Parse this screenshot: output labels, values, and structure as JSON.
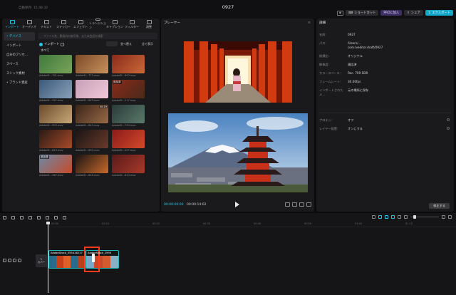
{
  "titlebar": {
    "autosave": "自動保存: 15:48:32",
    "title": "0927",
    "shortcut": "ショートカット",
    "pro": "PROに加入",
    "share": "シェア",
    "export": "エクスポート"
  },
  "toolbar": [
    {
      "label": "インポート",
      "icon": "import-icon",
      "active": true
    },
    {
      "label": "オーディオ",
      "icon": "audio-icon",
      "active": false
    },
    {
      "label": "テキスト",
      "icon": "text-icon",
      "active": false
    },
    {
      "label": "ステッカー",
      "icon": "sticker-icon",
      "active": false
    },
    {
      "label": "エフェクト",
      "icon": "effect-icon",
      "active": false
    },
    {
      "label": "トランジション",
      "icon": "transition-icon",
      "active": false
    },
    {
      "label": "キャプション",
      "icon": "caption-icon",
      "active": false
    },
    {
      "label": "フィルター",
      "icon": "filter-icon",
      "active": false
    },
    {
      "label": "調整",
      "icon": "adjust-icon",
      "active": false
    }
  ],
  "sidebar": [
    {
      "label": "• デバイス",
      "active": true
    },
    {
      "label": "インポート",
      "active": false
    },
    {
      "label": "自分のプリセ…",
      "active": false
    },
    {
      "label": "スペース",
      "active": false
    },
    {
      "label": "ストック素材",
      "active": false
    },
    {
      "label": "• ブランド資産",
      "active": false
    }
  ],
  "media": {
    "search_placeholder": "ファイル名、動画内の被写体、または会話を検索",
    "import_label": "インポート",
    "filter_label": "全て表示",
    "all_label": "すべて",
    "sort_label": "並べ替え",
    "items": [
      {
        "caption": "AdobeSt…791.mov",
        "duration": "",
        "badge": "",
        "colors": [
          "#3f7a3c",
          "#7aa35a"
        ]
      },
      {
        "caption": "AdobeSt…773.mov",
        "duration": "",
        "badge": "",
        "colors": [
          "#7a4a2a",
          "#c9915a"
        ]
      },
      {
        "caption": "AdobeSt…603.mov",
        "duration": "",
        "badge": "",
        "colors": [
          "#8a2a1a",
          "#c96a3a"
        ]
      },
      {
        "caption": "AdobeSt…421.mov",
        "duration": "",
        "badge": "",
        "colors": [
          "#3a5a7a",
          "#8aa0b8"
        ]
      },
      {
        "caption": "AdobeSt…643.mov",
        "duration": "",
        "badge": "",
        "colors": [
          "#c8a0b8",
          "#f0c8d8"
        ]
      },
      {
        "caption": "AdobeSt…217.mov",
        "duration": "",
        "badge": "追加済",
        "colors": [
          "#8a2a1a",
          "#4a2a1a"
        ]
      },
      {
        "caption": "AdobeSt…993.mov",
        "duration": "",
        "badge": "",
        "colors": [
          "#6a4a2a",
          "#c8a878"
        ]
      },
      {
        "caption": "AdobeSt…643.mov",
        "duration": "00:19",
        "badge": "",
        "colors": [
          "#3a2418",
          "#9a6a48"
        ]
      },
      {
        "caption": "AdobeSt…793.mov",
        "duration": "",
        "badge": "",
        "colors": [
          "#2a3a3a",
          "#5a7a6a"
        ]
      },
      {
        "caption": "AdobeSt…843.mov",
        "duration": "",
        "badge": "",
        "colors": [
          "#2a1a14",
          "#a84a2a"
        ]
      },
      {
        "caption": "AdobeSt…693.mov",
        "duration": "",
        "badge": "",
        "colors": [
          "#1a1414",
          "#6a3a2a"
        ]
      },
      {
        "caption": "AdobeSt…207.mov",
        "duration": "",
        "badge": "",
        "colors": [
          "#8a1a1a",
          "#d44a2a"
        ]
      },
      {
        "caption": "AdobeSt…267.mov",
        "duration": "",
        "badge": "追加済",
        "colors": [
          "#6a8aa8",
          "#c84a2a"
        ]
      },
      {
        "caption": "AdobeSt…846.mov",
        "duration": "",
        "badge": "",
        "colors": [
          "#1a1414",
          "#c86a2a"
        ]
      },
      {
        "caption": "AdobeSt…843.mov",
        "duration": "",
        "badge": "",
        "colors": [
          "#5a1a1a",
          "#a83a2a"
        ]
      }
    ]
  },
  "player": {
    "title": "プレーヤー",
    "current_time": "00:00:00:00",
    "total_time": "00:00:14:02"
  },
  "details": {
    "title": "詳細",
    "rows": [
      {
        "k": "名前:",
        "v": "0927"
      },
      {
        "k": "パス:",
        "v": "/Users/…\ncom.lveditor.draft/0927"
      },
      {
        "k": "縦横比:",
        "v": "オリジナル"
      },
      {
        "k": "解像度:",
        "v": "適応済"
      },
      {
        "k": "カラースペース:",
        "v": "Rec. 709 SDR"
      },
      {
        "k": "フレームレート:",
        "v": "30.00fps"
      },
      {
        "k": "インポートされたメ…",
        "v": "元の場所に保存"
      }
    ],
    "proxy_label": "プロキシ:",
    "proxy_value": "オフ",
    "layout_label": "レイヤー配置:",
    "layout_value": "オンにする",
    "modify_label": "修正する"
  },
  "timeline": {
    "ticks": [
      "00:00",
      "00:10",
      "00:20",
      "00:30",
      "00:40",
      "00:50",
      "01:00",
      "01:10"
    ],
    "cover_label": "カバー",
    "clips": [
      {
        "label": "AdobeStock_555416217",
        "colors": [
          "#2a6a8a",
          "#c8401a",
          "#e0602a",
          "#2a6a8a",
          "#b8401a"
        ]
      },
      {
        "label": "AdobeStock_2590",
        "colors": [
          "#7aa8c8",
          "#c84a2a",
          "#d45a30",
          "#8ab0c8"
        ]
      }
    ]
  }
}
